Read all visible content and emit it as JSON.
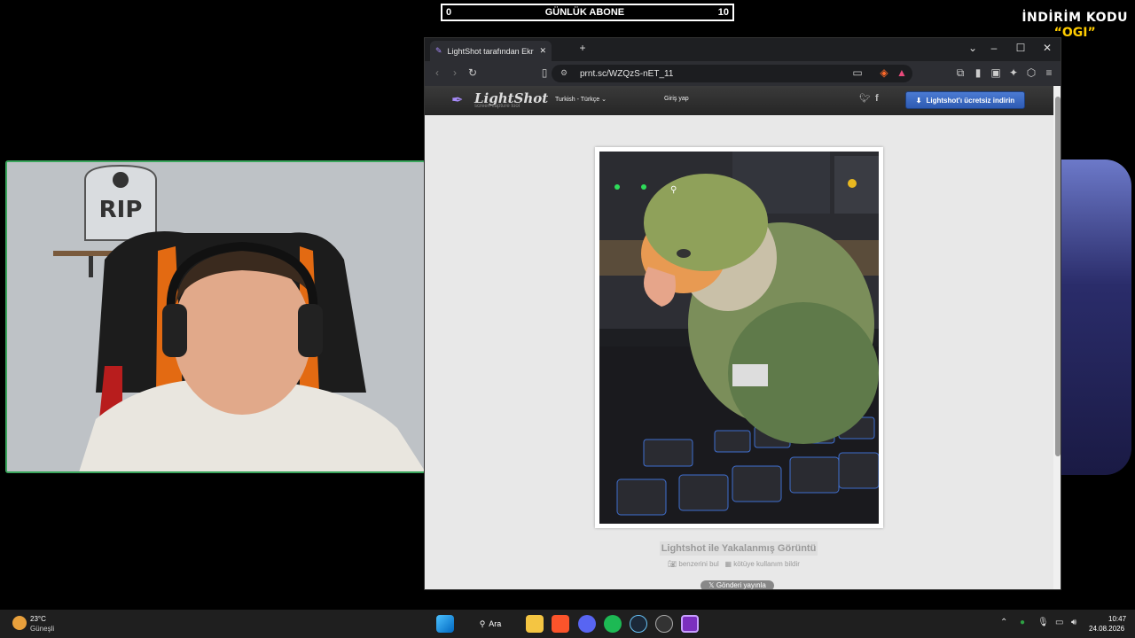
{
  "overlay": {
    "sub_left": "0",
    "sub_title": "GÜNLÜK ABONE",
    "sub_right": "10",
    "promo_line1": "İNDİRİM KODU",
    "promo_line2": "“OGI”"
  },
  "browser": {
    "tab_title": "LightShot tarafından Ekran Görü",
    "url": "prnt.sc/WZQzS-nET_11"
  },
  "lightshot": {
    "logo": "LightShot",
    "logo_sub": "screen capture tool",
    "language": "Turkish - Türkçe",
    "login": "Giriş yap",
    "download_button": "Lightshot'ı ücretsiz indirin",
    "caption": "Lightshot ile Yakalanmış Görüntü",
    "find_similar": "benzerini bul",
    "report": "kötüye kullanım bildir",
    "tweet_button": "Gönderi yayınla"
  },
  "taskbar": {
    "temp": "23°C",
    "weather": "Güneşli",
    "search": "Ara",
    "time": "10:47",
    "date": "24.08.2026"
  }
}
